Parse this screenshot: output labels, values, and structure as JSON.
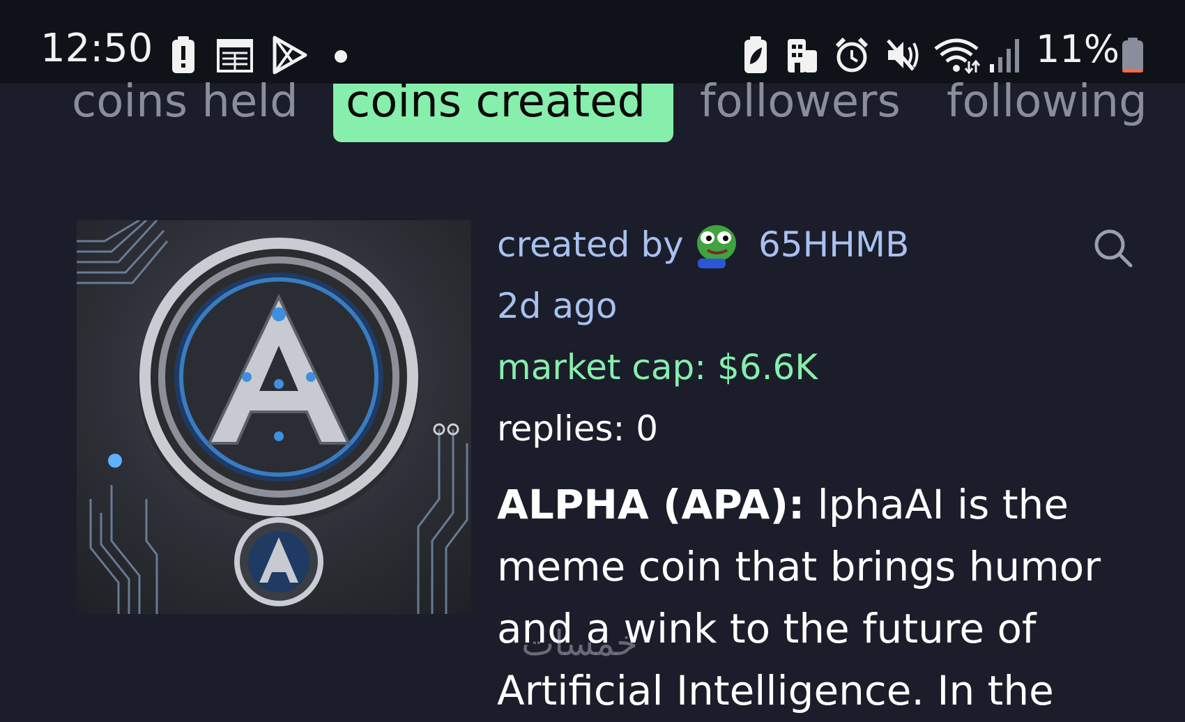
{
  "status_bar": {
    "time": "12:50",
    "battery_percent": "11%",
    "battery_level": 0.11,
    "icons_left": [
      "battery-alert-icon",
      "calendar-icon",
      "play-store-icon",
      "dot-icon"
    ],
    "icons_right": [
      "battery-saver-icon",
      "building-icon",
      "alarm-icon",
      "mute-icon",
      "wifi-icon",
      "signal-icon"
    ]
  },
  "tabs": [
    {
      "label": "coins held",
      "active": false
    },
    {
      "label": "coins created",
      "active": true
    },
    {
      "label": "followers",
      "active": false
    },
    {
      "label": "following",
      "active": false
    }
  ],
  "coin": {
    "image_icon": "alpha-coin-logo",
    "created_by_label": "created by",
    "creator": "65HHMB",
    "creator_avatar": "pepe-avatar-icon",
    "time_ago": "2d ago",
    "market_cap": "market cap: $6.6K",
    "replies": "replies: 0",
    "name": "ALPHA (APA):",
    "description": "lphaAI is the meme coin that brings humor and a wink to the future of Artificial Intelligence. In the"
  },
  "watermark": "خمسات",
  "colors": {
    "background": "#1b1d2a",
    "status_bar": "#10121a",
    "tab_active": "#86efac",
    "tab_inactive": "#8a8d9b",
    "creator_blue": "#a8c1f0",
    "market_cap_green": "#86efac"
  }
}
